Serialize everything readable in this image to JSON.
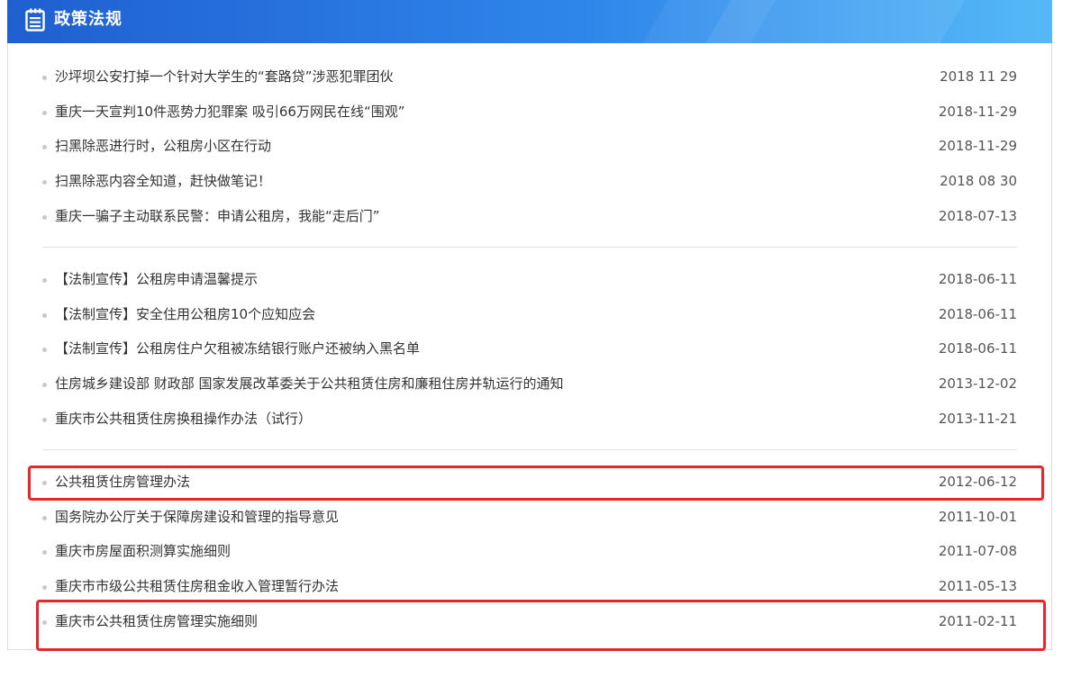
{
  "header": {
    "title": "政策法规",
    "icon": "notepad-icon"
  },
  "groups": [
    {
      "items": [
        {
          "title": "沙坪坝公安打掉一个针对大学生的“套路贷”涉恶犯罪团伙",
          "date": "2018 11 29"
        },
        {
          "title": "重庆一天宣判10件恶势力犯罪案 吸引66万网民在线“围观”",
          "date": "2018-11-29"
        },
        {
          "title": "扫黑除恶进行时，公租房小区在行动",
          "date": "2018-11-29"
        },
        {
          "title": "扫黑除恶内容全知道，赶快做笔记！",
          "date": "2018 08 30"
        },
        {
          "title": "重庆一骗子主动联系民警：申请公租房，我能“走后门”",
          "date": "2018-07-13"
        }
      ]
    },
    {
      "items": [
        {
          "title": "【法制宣传】公租房申请温馨提示",
          "date": "2018-06-11"
        },
        {
          "title": "【法制宣传】安全住用公租房10个应知应会",
          "date": "2018-06-11"
        },
        {
          "title": "【法制宣传】公租房住户欠租被冻结银行账户还被纳入黑名单",
          "date": "2018-06-11"
        },
        {
          "title": "住房城乡建设部 财政部 国家发展改革委关于公共租赁住房和廉租住房并轨运行的通知",
          "date": "2013-12-02"
        },
        {
          "title": "重庆市公共租赁住房换租操作办法（试行）",
          "date": "2013-11-21"
        }
      ]
    },
    {
      "items": [
        {
          "title": "公共租赁住房管理办法",
          "date": "2012-06-12"
        },
        {
          "title": "国务院办公厅关于保障房建设和管理的指导意见",
          "date": "2011-10-01"
        },
        {
          "title": "重庆市房屋面积测算实施细则",
          "date": "2011-07-08"
        },
        {
          "title": "重庆市市级公共租赁住房租金收入管理暂行办法",
          "date": "2011-05-13"
        },
        {
          "title": "重庆市公共租赁住房管理实施细则",
          "date": "2011-02-11"
        }
      ]
    }
  ],
  "colors": {
    "highlight": "#e8262b",
    "header_start": "#1f5fd0",
    "header_end": "#55b9f7"
  }
}
